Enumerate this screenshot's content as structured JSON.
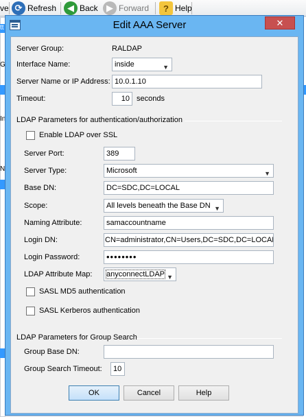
{
  "background": {
    "toolbar": {
      "items": [
        "ve",
        "Refresh",
        "Back",
        "Forward",
        "Help"
      ]
    },
    "fragments": [
      "tt",
      "Gr",
      "In",
      "Na",
      "e",
      "te n"
    ]
  },
  "dialog": {
    "title": "Edit AAA Server",
    "close_glyph": "✕",
    "server_group": {
      "label": "Server Group:",
      "value": "RALDAP"
    },
    "interface_name": {
      "label": "Interface Name:",
      "value": "inside"
    },
    "server_name": {
      "label": "Server Name or IP Address:",
      "value": "10.0.1.10"
    },
    "timeout": {
      "label": "Timeout:",
      "value": "10",
      "unit": "seconds"
    },
    "ldap_section": {
      "title": "LDAP Parameters for authentication/authorization",
      "enable_ssl_label": "Enable LDAP over SSL",
      "enable_ssl_checked": false,
      "server_port": {
        "label": "Server Port:",
        "value": "389"
      },
      "server_type": {
        "label": "Server Type:",
        "value": "Microsoft"
      },
      "base_dn": {
        "label": "Base DN:",
        "value": "DC=SDC,DC=LOCAL"
      },
      "scope": {
        "label": "Scope:",
        "value": "All levels beneath the Base DN"
      },
      "naming_attribute": {
        "label": "Naming Attribute:",
        "value": "samaccountname"
      },
      "login_dn": {
        "label": "Login DN:",
        "value": "CN=administrator,CN=Users,DC=SDC,DC=LOCAL"
      },
      "login_password": {
        "label": "Login Password:",
        "value": "••••••••"
      },
      "attribute_map": {
        "label": "LDAP Attribute Map:",
        "value": "anyconnectLDAP"
      },
      "sasl_md5_label": "SASL MD5 authentication",
      "sasl_md5_checked": false,
      "sasl_kerberos_label": "SASL Kerberos authentication",
      "sasl_kerberos_checked": false
    },
    "group_search_section": {
      "title": "LDAP Parameters for Group Search",
      "group_base_dn": {
        "label": "Group Base DN:",
        "value": ""
      },
      "group_search_timeout": {
        "label": "Group Search Timeout:",
        "value": "10"
      }
    },
    "buttons": {
      "ok": "OK",
      "cancel": "Cancel",
      "help": "Help"
    }
  },
  "colors": {
    "title_bar": "#6ab6f2",
    "close_button": "#c75050",
    "dialog_client": "#f0f0f0",
    "default_button": "#c4e0fa"
  }
}
